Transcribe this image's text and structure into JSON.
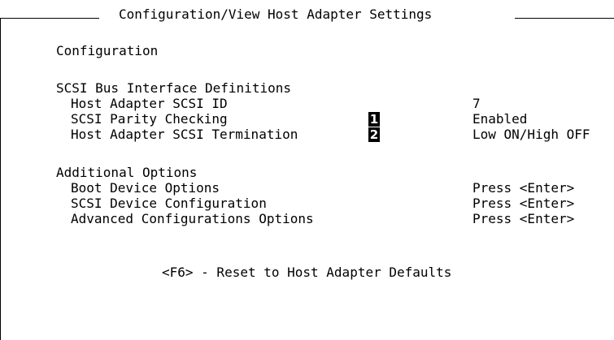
{
  "window": {
    "title": "Configuration/View Host Adapter Settings"
  },
  "configuration_heading": "Configuration",
  "scsi_bus": {
    "heading": "SCSI Bus Interface Definitions",
    "items": [
      {
        "label": "Host Adapter SCSI ID",
        "value": "7",
        "marker": ""
      },
      {
        "label": "SCSI Parity Checking",
        "value": "Enabled",
        "marker": "1"
      },
      {
        "label": "Host Adapter SCSI Termination",
        "value": "Low ON/High OFF",
        "marker": "2"
      }
    ]
  },
  "additional_options": {
    "heading": "Additional Options",
    "items": [
      {
        "label": "Boot Device Options",
        "value": "Press <Enter>"
      },
      {
        "label": "SCSI Device Configuration",
        "value": "Press <Enter>"
      },
      {
        "label": "Advanced Configurations Options",
        "value": "Press <Enter>"
      }
    ]
  },
  "footer": {
    "reset_hint": "<F6> - Reset to Host Adapter Defaults"
  }
}
